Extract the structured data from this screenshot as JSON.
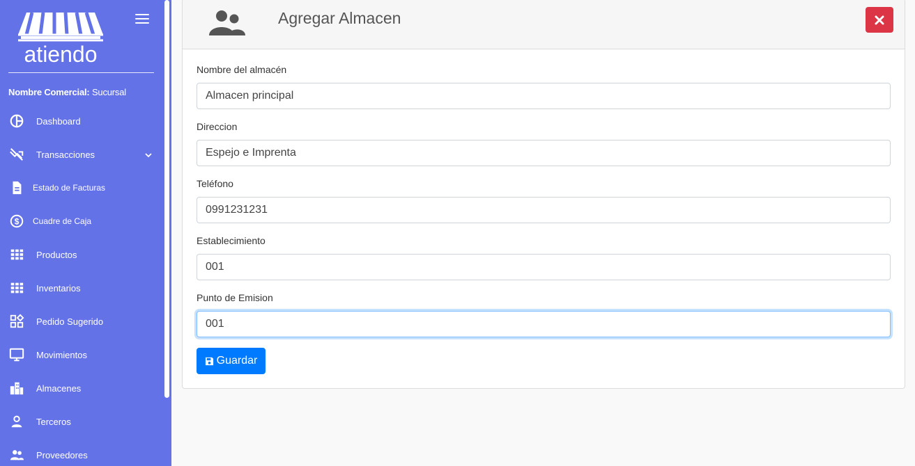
{
  "sidebar": {
    "logo_text": "atiendo",
    "commercial_label": "Nombre Comercial:",
    "commercial_value": "Sucursal",
    "items": [
      {
        "label": "Dashboard",
        "icon": "dashboard-icon"
      },
      {
        "label": "Transacciones",
        "icon": "transactions-icon",
        "has_submenu": true
      },
      {
        "label": "Estado de Facturas",
        "icon": "document-icon"
      },
      {
        "label": "Cuadre de Caja",
        "icon": "dollar-circle-icon"
      },
      {
        "label": "Productos",
        "icon": "grid-icon"
      },
      {
        "label": "Inventarios",
        "icon": "grid-icon"
      },
      {
        "label": "Pedido Sugerido",
        "icon": "widgets-icon"
      },
      {
        "label": "Movimientos",
        "icon": "monitor-icon"
      },
      {
        "label": "Almacenes",
        "icon": "buildings-icon"
      },
      {
        "label": "Terceros",
        "icon": "person-icon"
      },
      {
        "label": "Proveedores",
        "icon": "people-icon"
      }
    ]
  },
  "form": {
    "title": "Agregar Almacen",
    "fields": [
      {
        "label": "Nombre del almacén",
        "value": "Almacen principal"
      },
      {
        "label": "Direccion",
        "value": "Espejo e Imprenta"
      },
      {
        "label": "Teléfono",
        "value": "0991231231"
      },
      {
        "label": "Establecimiento",
        "value": "001"
      },
      {
        "label": "Punto de Emision",
        "value": "001"
      }
    ],
    "save_label": "Guardar"
  },
  "colors": {
    "sidebar_bg": "#6472e8",
    "primary": "#007bff",
    "danger": "#dc3545"
  }
}
